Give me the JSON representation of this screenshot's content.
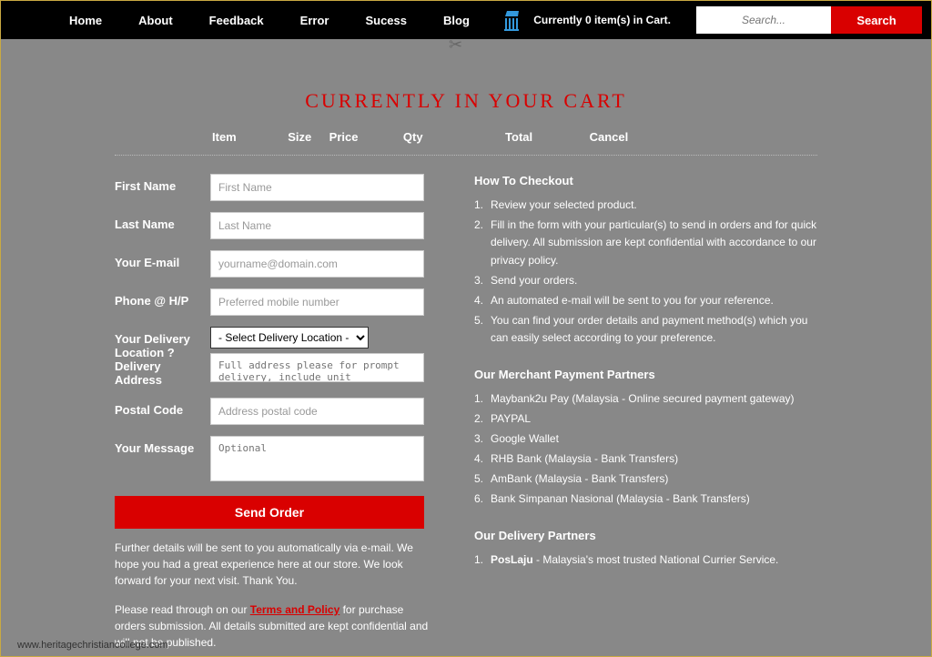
{
  "nav": [
    "Home",
    "About",
    "Feedback",
    "Error",
    "Sucess",
    "Blog"
  ],
  "cart_status": {
    "prefix": "Currently ",
    "count": "0",
    "suffix": " item(s) in Cart."
  },
  "search": {
    "placeholder": "Search...",
    "button": "Search"
  },
  "page_title": "CURRENTLY IN YOUR CART",
  "cart_cols": {
    "item": "Item",
    "size": "Size",
    "price": "Price",
    "qty": "Qty",
    "total": "Total",
    "cancel": "Cancel"
  },
  "form": {
    "fname": {
      "label": "First Name",
      "ph": "First Name"
    },
    "lname": {
      "label": "Last Name",
      "ph": "Last Name"
    },
    "email": {
      "label": "Your E-mail",
      "ph": "yourname@domain.com"
    },
    "phone": {
      "label": "Phone @ H/P",
      "ph": "Preferred mobile number"
    },
    "location": {
      "label": "Your Delivery Location ? Delivery Address",
      "selected": "- Select Delivery Location -",
      "ph": "Full address please for prompt delivery, include unit"
    },
    "postal": {
      "label": "Postal Code",
      "ph": "Address postal code"
    },
    "message": {
      "label": "Your Message",
      "ph": "Optional"
    },
    "submit": "Send Order"
  },
  "note1": "Further details will be sent to you automatically via e-mail. We hope you had a great experience here at our store. We look forward for your next visit. Thank You.",
  "note2a": "Please read through on our ",
  "note2link": "Terms and Policy",
  "note2b": " for purchase orders submission. All details submitted are kept confidential and will not be published.",
  "howto_heading": "How To Checkout",
  "howto": [
    "Review your selected product.",
    "Fill in the form with your particular(s) to send in orders and for quick delivery. All submission are kept confidential with accordance to our privacy policy.",
    "Send your orders.",
    "An automated e-mail will be sent to you for your reference.",
    "You can find your order details and payment method(s) which you can easily select according to your preference."
  ],
  "merchants_heading": "Our Merchant Payment Partners",
  "merchants": [
    "Maybank2u Pay (Malaysia - Online secured payment gateway)",
    "PAYPAL",
    "Google Wallet",
    "RHB Bank (Malaysia - Bank Transfers)",
    "AmBank (Malaysia - Bank Transfers)",
    "Bank Simpanan Nasional (Malaysia - Bank Transfers)"
  ],
  "delivery_heading": "Our Delivery Partners",
  "delivery_bold": "PosLaju",
  "delivery_rest": " - Malaysia's most trusted National Currier Service.",
  "watermark": "www.heritagechristiancollege.com"
}
